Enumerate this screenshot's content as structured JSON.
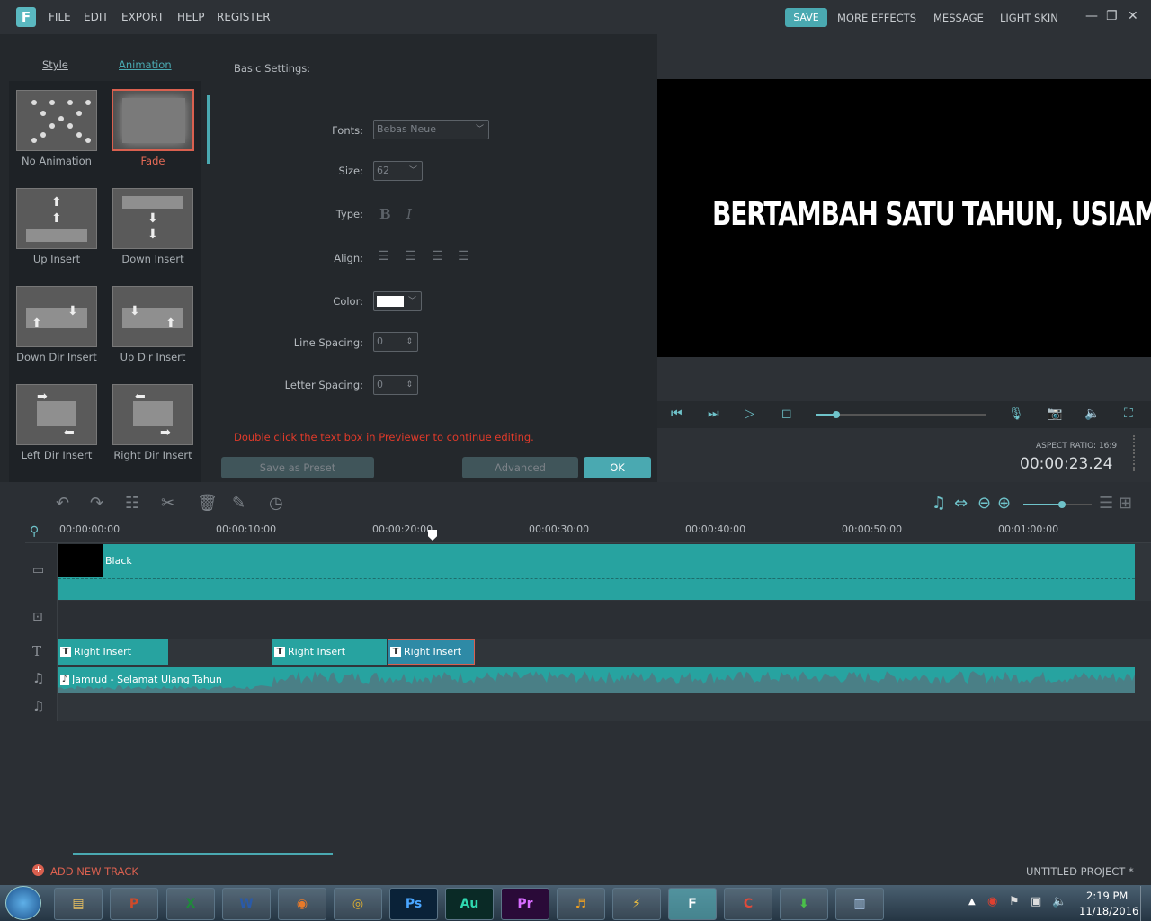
{
  "menu": {
    "logo": "F",
    "file": "FILE",
    "edit": "EDIT",
    "export": "EXPORT",
    "help": "HELP",
    "register": "REGISTER",
    "save": "SAVE",
    "more_effects": "MORE EFFECTS",
    "message": "MESSAGE",
    "light_skin": "LIGHT SKIN"
  },
  "tabs": {
    "style": "Style",
    "animation": "Animation"
  },
  "animations": [
    "No Animation",
    "Fade",
    "Up Insert",
    "Down Insert",
    "Down Dir Insert",
    "Up Dir Insert",
    "Left Dir Insert",
    "Right Dir Insert"
  ],
  "settings": {
    "title": "Basic Settings:",
    "fonts_label": "Fonts:",
    "fonts_value": "Bebas Neue",
    "size_label": "Size:",
    "size_value": "62",
    "type_label": "Type:",
    "bold": "B",
    "italic": "I",
    "align_label": "Align:",
    "color_label": "Color:",
    "line_spacing_label": "Line Spacing:",
    "line_spacing_value": "0",
    "letter_spacing_label": "Letter Spacing:",
    "letter_spacing_value": "0",
    "hint": "Double click the text box in Previewer to continue editing.",
    "save_preset": "Save as Preset",
    "advanced": "Advanced",
    "ok": "OK"
  },
  "preview": {
    "text": "BERTAMBAH SATU TAHUN, USIAMU,",
    "aspect": "ASPECT RATIO: 16:9",
    "timecode": "00:00:23.24",
    "progress": 0.12,
    "volume": 0.5
  },
  "timeline": {
    "ticks": [
      "00:00:00:00",
      "00:00:10:00",
      "00:00:20:00",
      "00:00:30:00",
      "00:00:40:00",
      "00:00:50:00",
      "00:01:00:00"
    ],
    "video_clip": "Black",
    "text_clips": [
      "Right Insert",
      "Right Insert",
      "Right Insert"
    ],
    "audio_clip": "Jamrud - Selamat Ulang Tahun"
  },
  "footer": {
    "add_track": "ADD NEW TRACK",
    "project": "UNTITLED PROJECT *"
  },
  "taskbar": {
    "time": "2:19 PM",
    "date": "11/18/2016"
  }
}
